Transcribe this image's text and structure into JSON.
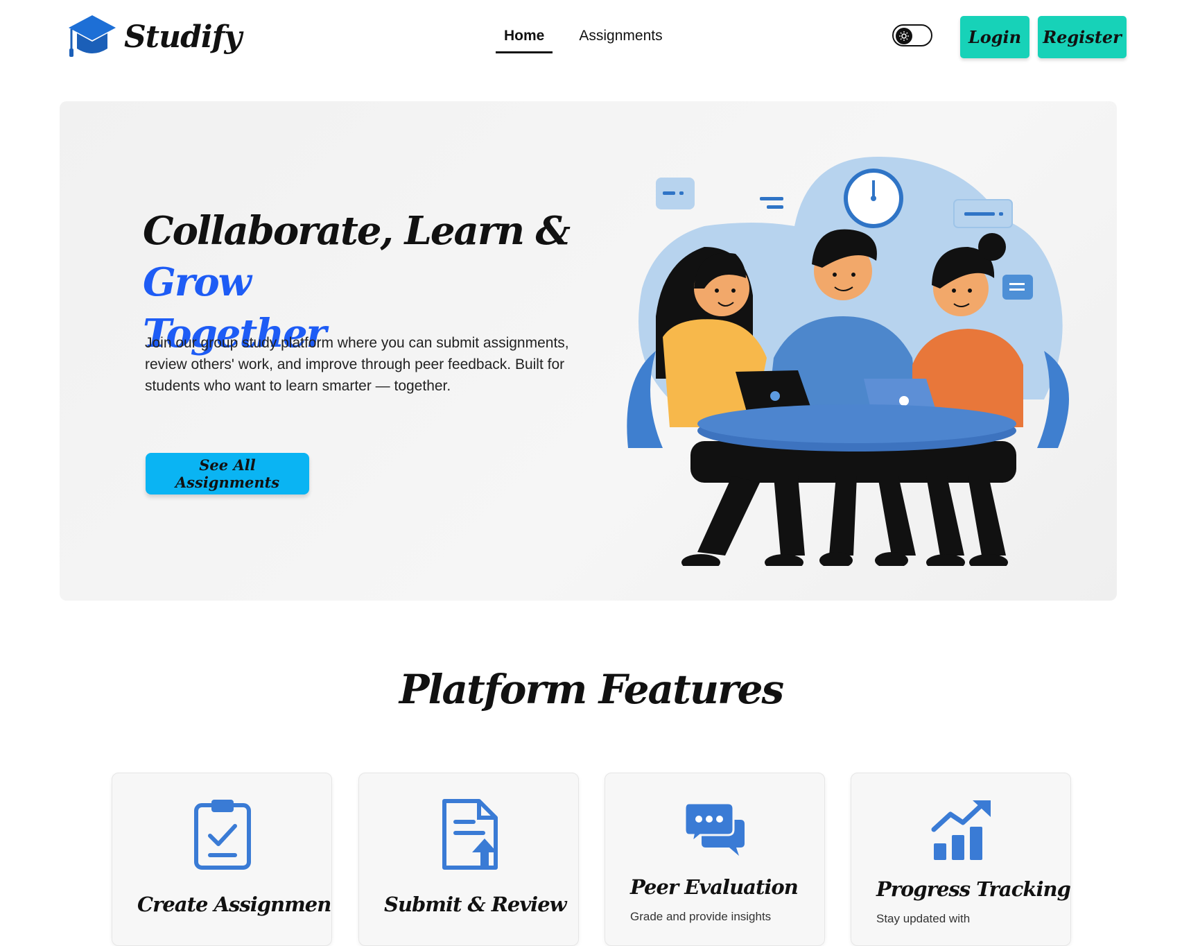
{
  "brand": {
    "name": "Studify",
    "icon": "graduation-cap-icon"
  },
  "nav": {
    "links": [
      {
        "label": "Home",
        "active": true
      },
      {
        "label": "Assignments",
        "active": false
      }
    ],
    "theme_toggle_icon": "sun-icon",
    "login_label": "Login",
    "register_label": "Register"
  },
  "hero": {
    "title_line1": "Collaborate, Learn & ",
    "title_accent1": "Grow",
    "title_accent2": "Together",
    "description": "Join our group study platform where you can submit assignments, review others' work, and improve through peer feedback. Built for students who want to learn smarter — together.",
    "cta_label": "See All Assignments",
    "illustration": "students-collaborating-illustration"
  },
  "features": {
    "heading": "Platform Features",
    "items": [
      {
        "title": "Create Assignments",
        "description": "",
        "icon": "clipboard-check-icon"
      },
      {
        "title": "Submit & Review",
        "description": "",
        "icon": "file-upload-icon"
      },
      {
        "title": "Peer Evaluation",
        "description": "Grade and provide insights",
        "icon": "chat-bubbles-icon"
      },
      {
        "title": "Progress Tracking",
        "description": "Stay updated with",
        "icon": "chart-growth-icon"
      }
    ]
  },
  "colors": {
    "accent_blue": "#1e5cf5",
    "teal_button": "#17d2b8",
    "cta_blue": "#0ab4f3",
    "icon_blue": "#3a7bd5"
  }
}
